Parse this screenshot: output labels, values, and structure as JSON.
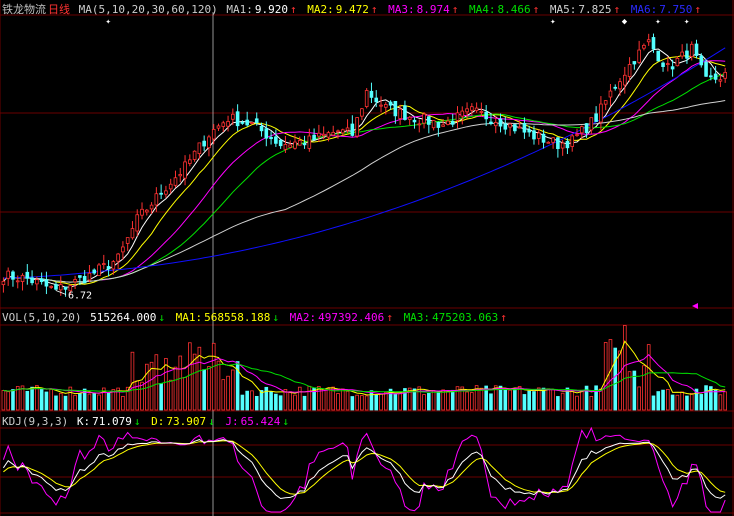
{
  "stock": {
    "name": "铁龙物流",
    "period": "日线"
  },
  "colors": {
    "bg": "#000000",
    "grid": "#6a0000",
    "up": "#ff3232",
    "down": "#54ffff",
    "ma1": "#ffffff",
    "ma2": "#ffff00",
    "ma3": "#ff00ff",
    "ma4": "#00e000",
    "ma5": "#d0d0d0",
    "ma6": "#0000ff",
    "text": "#c0c0c0"
  },
  "price_header": {
    "ma_params": "MA(5,10,20,30,60,120)",
    "items": [
      {
        "label": "MA1:",
        "value": "9.920",
        "arrow": "↑",
        "color": "#ffffff"
      },
      {
        "label": "MA2:",
        "value": "9.472",
        "arrow": "↑",
        "color": "#ffff00"
      },
      {
        "label": "MA3:",
        "value": "8.974",
        "arrow": "↑",
        "color": "#ff00ff"
      },
      {
        "label": "MA4:",
        "value": "8.466",
        "arrow": "↑",
        "color": "#00e000"
      },
      {
        "label": "MA5:",
        "value": "7.825",
        "arrow": "↑",
        "color": "#d0d0d0"
      },
      {
        "label": "MA6:",
        "value": "7.750",
        "arrow": "↑",
        "color": "#0000ff"
      }
    ]
  },
  "vol_header": {
    "params": "VOL(5,10,20)",
    "value": "515264.000",
    "value_arrow": "↓",
    "items": [
      {
        "label": "MA1:",
        "value": "568558.188",
        "arrow": "↓",
        "color": "#ffff00"
      },
      {
        "label": "MA2:",
        "value": "497392.406",
        "arrow": "↑",
        "color": "#ff00ff"
      },
      {
        "label": "MA3:",
        "value": "475203.063",
        "arrow": "↑",
        "color": "#00e000"
      }
    ]
  },
  "kdj_header": {
    "params": "KDJ(9,3,3)",
    "items": [
      {
        "label": "K:",
        "value": "71.079",
        "arrow": "↓",
        "color": "#ffffff"
      },
      {
        "label": "D:",
        "value": "73.907",
        "arrow": "↓",
        "color": "#ffff00"
      },
      {
        "label": "J:",
        "value": "65.424",
        "arrow": "↓",
        "color": "#ff00ff"
      }
    ]
  },
  "chart_data": [
    {
      "type": "candlestick",
      "title": "铁龙物流 日线",
      "low_label": "6.72",
      "price_range": [
        6.5,
        10.9
      ],
      "ma_current": {
        "MA1": 9.92,
        "MA2": 9.472,
        "MA3": 8.974,
        "MA4": 8.466,
        "MA5": 7.825,
        "MA6": 7.75
      },
      "anchors": [
        {
          "i": 0,
          "p": 6.95
        },
        {
          "i": 5,
          "p": 6.9
        },
        {
          "i": 9,
          "p": 6.78
        },
        {
          "i": 11,
          "p": 6.72
        },
        {
          "i": 18,
          "p": 6.95
        },
        {
          "i": 24,
          "p": 7.2
        },
        {
          "i": 28,
          "p": 7.8
        },
        {
          "i": 34,
          "p": 8.3
        },
        {
          "i": 38,
          "p": 8.6
        },
        {
          "i": 43,
          "p": 9.1
        },
        {
          "i": 47,
          "p": 9.35
        },
        {
          "i": 52,
          "p": 9.25
        },
        {
          "i": 58,
          "p": 8.95
        },
        {
          "i": 64,
          "p": 9.0
        },
        {
          "i": 70,
          "p": 9.15
        },
        {
          "i": 73,
          "p": 9.1
        },
        {
          "i": 76,
          "p": 9.75
        },
        {
          "i": 80,
          "p": 9.5
        },
        {
          "i": 86,
          "p": 9.35
        },
        {
          "i": 92,
          "p": 9.25
        },
        {
          "i": 98,
          "p": 9.45
        },
        {
          "i": 104,
          "p": 9.3
        },
        {
          "i": 110,
          "p": 9.1
        },
        {
          "i": 116,
          "p": 8.95
        },
        {
          "i": 119,
          "p": 9.0
        },
        {
          "i": 124,
          "p": 9.35
        },
        {
          "i": 128,
          "p": 9.85
        },
        {
          "i": 132,
          "p": 10.25
        },
        {
          "i": 135,
          "p": 10.5
        },
        {
          "i": 139,
          "p": 10.1
        },
        {
          "i": 144,
          "p": 10.4
        },
        {
          "i": 147,
          "p": 9.9
        },
        {
          "i": 151,
          "p": 10.0
        }
      ]
    },
    {
      "type": "bar",
      "title": "VOL(5,10,20)",
      "last_value": 515264,
      "ma": {
        "MA1": 568558.188,
        "MA2": 497392.406,
        "MA3": 475203.063
      },
      "max": 1150000
    },
    {
      "type": "line",
      "title": "KDJ(9,3,3)",
      "last": {
        "K": 71.079,
        "D": 73.907,
        "J": 65.424
      },
      "ylim": [
        0,
        110
      ]
    }
  ]
}
